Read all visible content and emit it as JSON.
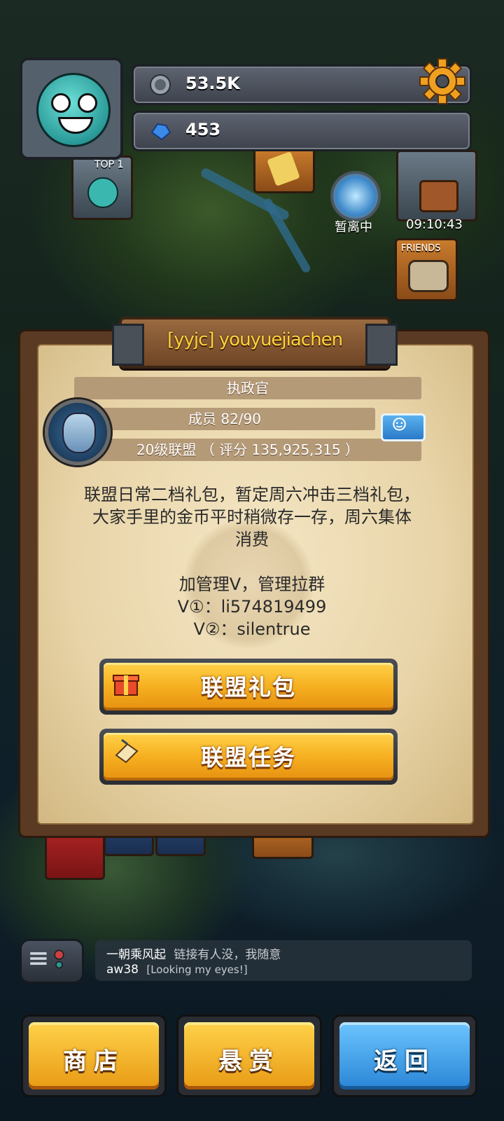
{
  "hud": {
    "silver_value": "53.5K",
    "gem_value": "453"
  },
  "map": {
    "top_badge": "TOP 1",
    "portal_status": "暂离中",
    "chest_timer": "09:10:43",
    "friends_label": "FRIENDS"
  },
  "alliance": {
    "name": "[yyjc] youyuejiachen",
    "rank": "执政官",
    "members": "成员 82/90",
    "level_score": "20级联盟 （ 评分 135,925,315 ）",
    "notice_lines": [
      "联盟日常二档礼包，暂定周六冲击三档礼包，",
      "大家手里的金币平时稍微存一存，周六集体",
      "消费",
      "",
      "加管理V，管理拉群",
      "V①：li574819499",
      "V②：silentrue"
    ],
    "gift_button": "联盟礼包",
    "task_button": "联盟任务"
  },
  "chat": {
    "line1_user": "一朝乘风起",
    "line1_text": "链接有人没，我随意",
    "line2_user": "aw38",
    "line2_text": "[Looking my eyes!]"
  },
  "nav": {
    "shop": "商店",
    "bounty": "悬赏",
    "back": "返回"
  },
  "colors": {
    "title_gold": "#ffd23a",
    "button_orange": "#f6b020",
    "back_blue": "#2a86d6"
  }
}
